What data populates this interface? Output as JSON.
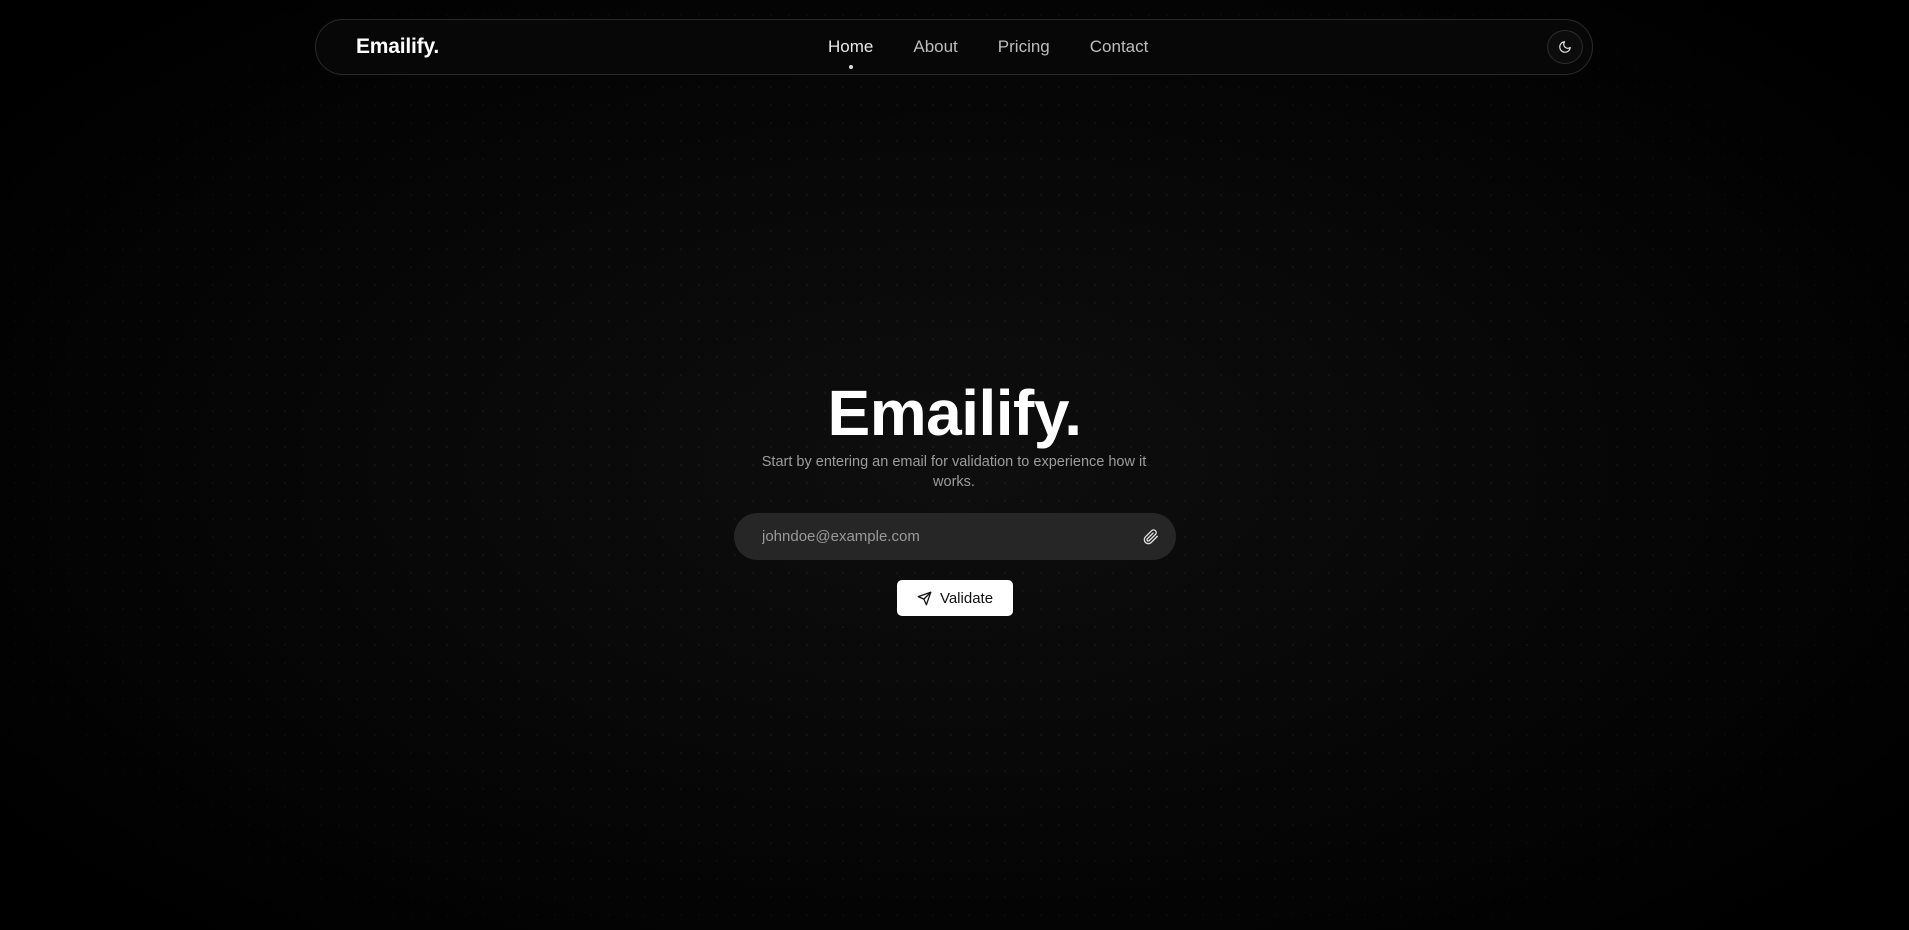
{
  "navbar": {
    "logo": "Emailify.",
    "links": [
      {
        "label": "Home",
        "active": true
      },
      {
        "label": "About",
        "active": false
      },
      {
        "label": "Pricing",
        "active": false
      },
      {
        "label": "Contact",
        "active": false
      }
    ],
    "theme_toggle_icon": "moon-icon"
  },
  "hero": {
    "title": "Emailify.",
    "subtitle": "Start by entering an email for validation to experience how it works."
  },
  "form": {
    "email_value": "",
    "email_placeholder": "johndoe@example.com",
    "attach_icon": "paperclip-icon",
    "submit_label": "Validate",
    "submit_icon": "send-icon"
  },
  "colors": {
    "background": "#050505",
    "input_background": "#262626",
    "button_background": "#ffffff",
    "text_primary": "#ffffff",
    "text_muted": "#9c9c9c"
  }
}
